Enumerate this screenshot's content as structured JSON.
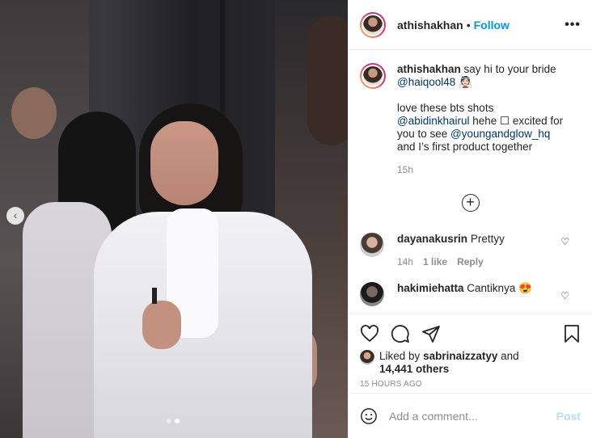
{
  "post": {
    "author": "athishakhan",
    "separator": "•",
    "follow_label": "Follow",
    "more_label": "•••"
  },
  "caption": {
    "author": "athishakhan",
    "line1": "say hi to your bride",
    "mention1": "@haiqool48",
    "emoji1": "👰🏻",
    "para2_a": "love these bts shots",
    "mention2": "@abidinkhairul",
    "para2_b": " hehe ☐ excited for you to see ",
    "mention3": "@youngandglow_hq",
    "para2_c": "and I’s first product together",
    "time": "15h"
  },
  "load_more_icon": "plus-circle-icon",
  "comments": [
    {
      "user": "dayanakusrin",
      "text": "Prettyy",
      "time": "14h",
      "likes": "1 like",
      "reply": "Reply"
    },
    {
      "user": "hakimiehatta",
      "text": "Cantiknya 😍"
    }
  ],
  "actions": {
    "like_icon": "heart-icon",
    "comment_icon": "comment-icon",
    "share_icon": "paper-plane-icon",
    "save_icon": "bookmark-icon"
  },
  "likes": {
    "prefix": "Liked by",
    "user": "sabrinaizzatyy",
    "and": "and",
    "count": "14,441 others"
  },
  "timestamp": "15 HOURS AGO",
  "add_comment": {
    "placeholder": "Add a comment...",
    "post_label": "Post"
  },
  "carousel": {
    "prev_label": "‹",
    "current": 2,
    "total": 2
  },
  "colors": {
    "link": "#0095f6",
    "mention": "#00376b",
    "muted": "#8e8e8e",
    "post_disabled": "#b2dffc"
  }
}
